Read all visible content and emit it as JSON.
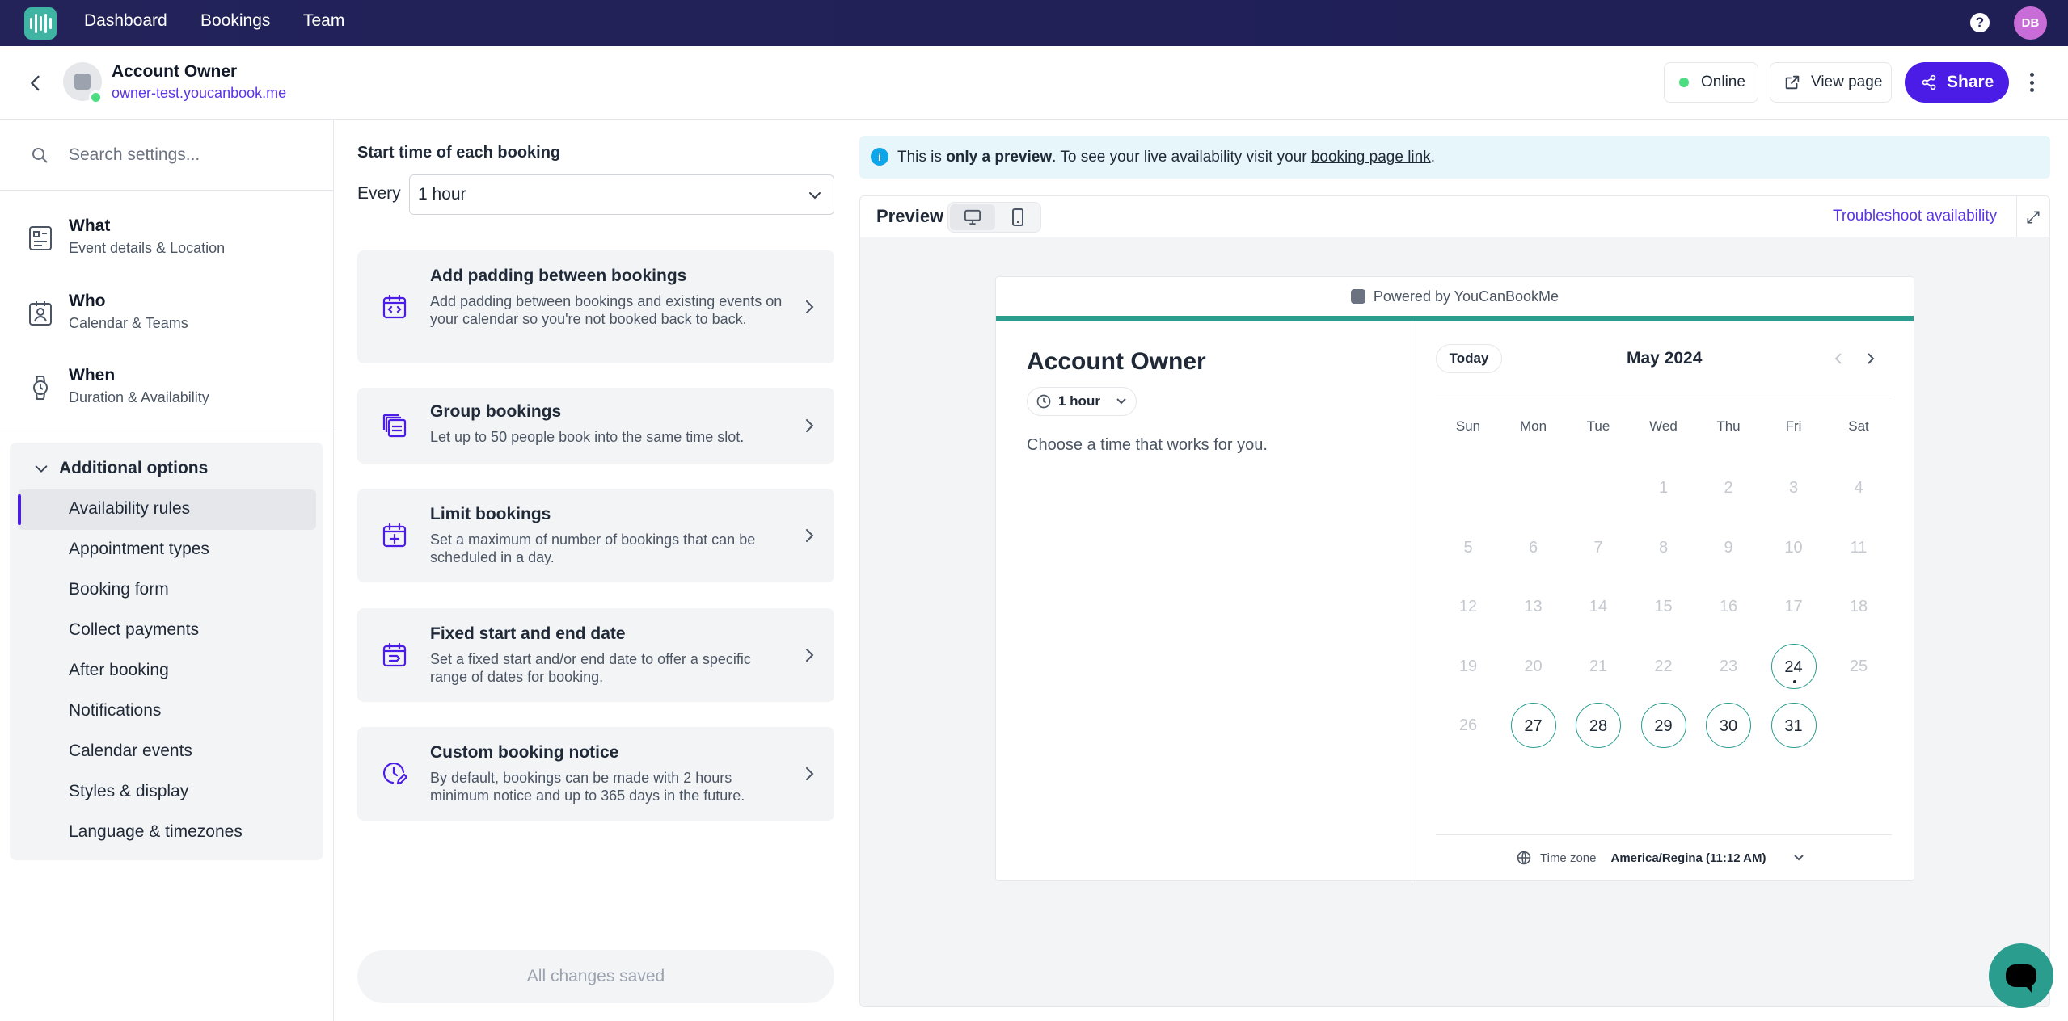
{
  "topnav": {
    "links": [
      "Dashboard",
      "Bookings",
      "Team"
    ],
    "help_icon": "question-icon",
    "avatar_initials": "DB"
  },
  "header": {
    "account_name": "Account Owner",
    "account_url": "owner-test.youcanbook.me",
    "status_label": "Online",
    "view_label": "View page",
    "share_label": "Share"
  },
  "sidebar": {
    "search_placeholder": "Search settings...",
    "sections": [
      {
        "title": "What",
        "subtitle": "Event details & Location",
        "icon": "document-icon"
      },
      {
        "title": "Who",
        "subtitle": "Calendar & Teams",
        "icon": "person-badge-icon"
      },
      {
        "title": "When",
        "subtitle": "Duration & Availability",
        "icon": "watch-icon"
      }
    ],
    "additional_title": "Additional options",
    "additional_items": [
      "Availability rules",
      "Appointment types",
      "Booking form",
      "Collect payments",
      "After booking",
      "Notifications",
      "Calendar events",
      "Styles & display",
      "Language & timezones"
    ],
    "active_item": "Availability rules"
  },
  "middle": {
    "start_label": "Start time of each booking",
    "every_label": "Every",
    "every_value": "1 hour",
    "cards": [
      {
        "title": "Add padding between bookings",
        "desc": "Add padding between bookings and existing events on your calendar so you're not booked back to back.",
        "icon": "calendar-code-icon"
      },
      {
        "title": "Group bookings",
        "desc": "Let up to 50 people book into the same time slot.",
        "icon": "stack-icon"
      },
      {
        "title": "Limit bookings",
        "desc": "Set a maximum of number of bookings that can be scheduled in a day.",
        "icon": "calendar-plus-icon"
      },
      {
        "title": "Fixed start and end date",
        "desc": "Set a fixed start and/or end date to offer a specific range of dates for booking.",
        "icon": "calendar-range-icon"
      },
      {
        "title": "Custom booking notice",
        "desc": "By default, bookings can be made with 2 hours minimum notice and up to 365 days in the future.",
        "icon": "clock-edit-icon"
      }
    ],
    "saved_label": "All changes saved"
  },
  "notice": {
    "pre": "This is ",
    "strong": "only a preview",
    "mid": ". To see your live availability visit your ",
    "link": "booking page link",
    "post": "."
  },
  "preview": {
    "title": "Preview",
    "troubleshoot": "Troubleshoot availability",
    "powered": "Powered by YouCanBookMe",
    "name": "Account Owner",
    "duration": "1 hour",
    "choose": "Choose a time that works for you.",
    "today_label": "Today",
    "month": "May 2024",
    "weekdays": [
      "Sun",
      "Mon",
      "Tue",
      "Wed",
      "Thu",
      "Fri",
      "Sat"
    ],
    "first_weekday_index": 3,
    "days_in_month": 31,
    "available_days": [
      24,
      27,
      28,
      29,
      30,
      31
    ],
    "today": 24,
    "timezone_label": "Time zone",
    "timezone_value": "America/Regina (11:12 AM)"
  },
  "colors": {
    "brand": "#4b1ce6",
    "teal": "#2a9d8f",
    "nav": "#23235a"
  }
}
